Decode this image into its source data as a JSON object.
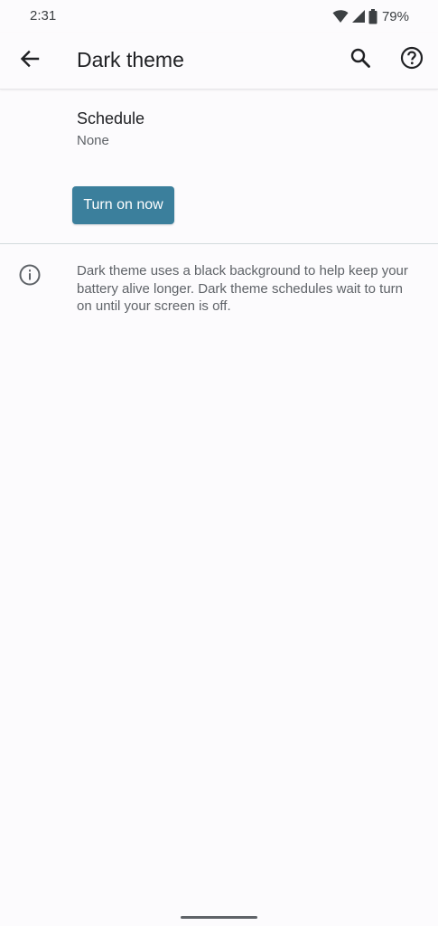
{
  "status_bar": {
    "time": "2:31",
    "battery_percent": "79%",
    "icons": [
      "wifi-icon",
      "cell-signal-icon",
      "battery-icon"
    ]
  },
  "app_bar": {
    "title": "Dark theme",
    "icons": [
      "back-arrow-icon",
      "search-icon",
      "help-icon"
    ]
  },
  "schedule": {
    "title": "Schedule",
    "summary": "None"
  },
  "action": {
    "turn_on_label": "Turn on now"
  },
  "footer": {
    "icon": "info-icon",
    "text": "Dark theme uses a black background to help keep your battery alive longer. Dark theme schedules wait to turn on until your screen is off."
  },
  "colors": {
    "accent": "#3b7f9c",
    "background": "#fcfbfd",
    "primary_text": "#202124",
    "secondary_text": "#5f6368"
  }
}
